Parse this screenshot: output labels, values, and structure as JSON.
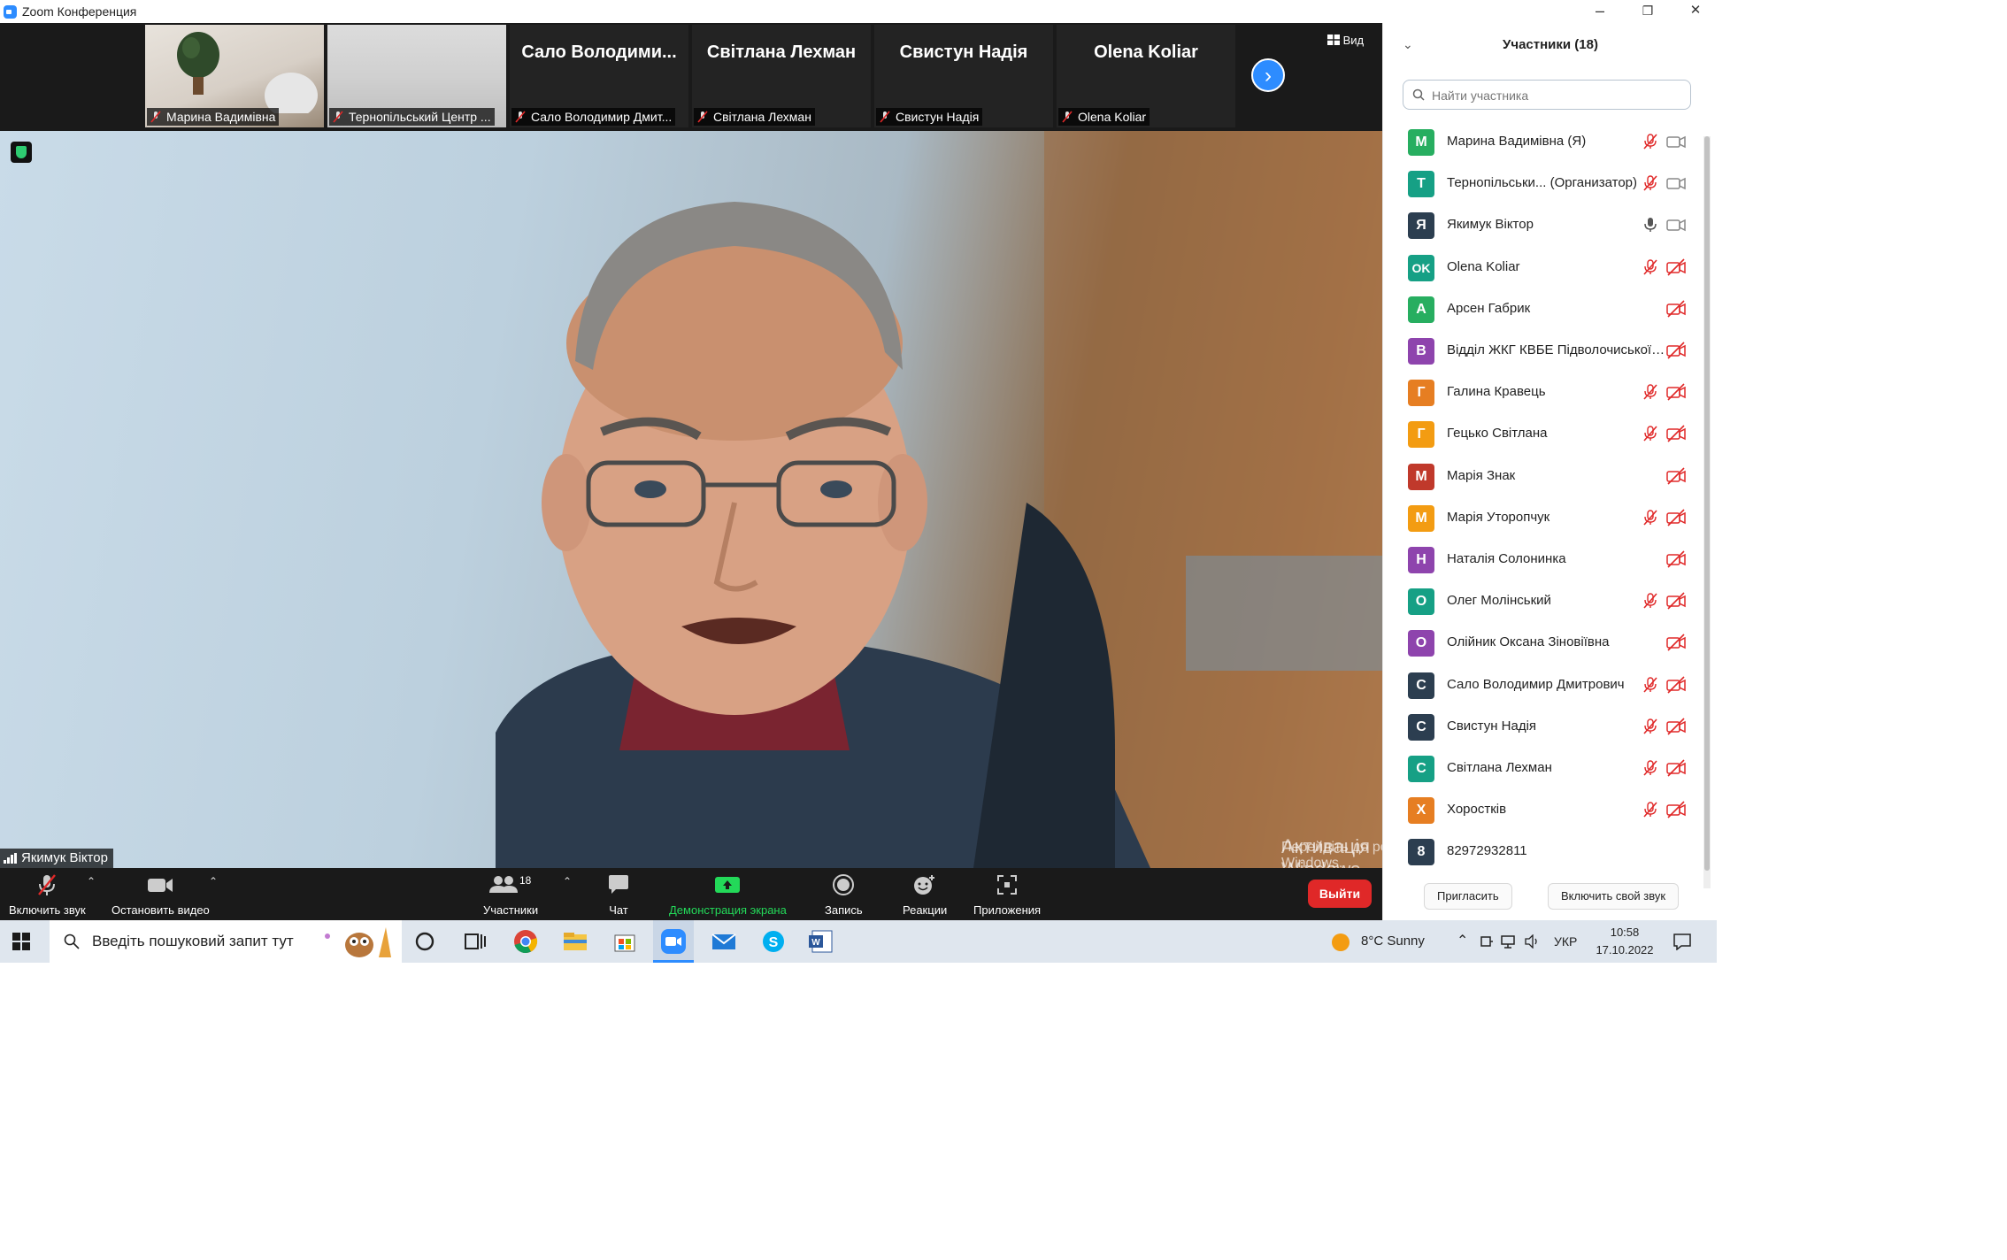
{
  "window": {
    "title": "Zoom Конференция",
    "minimize": "–",
    "maximize": "❐",
    "close": "✕"
  },
  "strip": {
    "view_label": "Вид",
    "tiles": [
      {
        "label": "Марина Вадимівна",
        "name": ""
      },
      {
        "label": "Тернопільський Центр ...",
        "name": ""
      },
      {
        "label": "Сало Володимир Дмит...",
        "name": "Сало  Володими..."
      },
      {
        "label": "Світлана Лехман",
        "name": "Світлана Лехман"
      },
      {
        "label": "Свистун Надія",
        "name": "Свистун Надія"
      },
      {
        "label": "Olena Koliar",
        "name": "Olena Koliar"
      }
    ]
  },
  "main": {
    "speaker": "Якимук Віктор"
  },
  "toolbar": {
    "mute": "Включить звук",
    "video": "Остановить видео",
    "participants": "Участники",
    "participants_count": "18",
    "chat": "Чат",
    "share": "Демонстрация экрана",
    "record": "Запись",
    "reactions": "Реакции",
    "apps": "Приложения",
    "leave": "Выйти"
  },
  "panel": {
    "title": "Участники (18)",
    "search_placeholder": "Найти участника",
    "invite": "Пригласить",
    "unmute_me": "Включить свой звук",
    "participants": [
      {
        "initial": "М",
        "name": "Марина Вадимівна  (Я)",
        "color": "#27ae60",
        "mic": "off",
        "cam": "on"
      },
      {
        "initial": "Т",
        "name": "Тернопільськи...  (Организатор)",
        "color": "#16a085",
        "mic": "off",
        "cam": "on"
      },
      {
        "initial": "Я",
        "name": "Якимук Віктор",
        "color": "#2c3e50",
        "mic": "on",
        "cam": "on"
      },
      {
        "initial": "OK",
        "name": "Olena Koliar",
        "color": "#16a085",
        "mic": "off",
        "cam": "off"
      },
      {
        "initial": "А",
        "name": "Арсен Габрик",
        "color": "#27ae60",
        "mic": "none",
        "cam": "off"
      },
      {
        "initial": "В",
        "name": "Відділ ЖКГ КВБЕ Підволочиської с...",
        "color": "#8e44ad",
        "mic": "none",
        "cam": "off"
      },
      {
        "initial": "Г",
        "name": "Галина Кравець",
        "color": "#e67e22",
        "mic": "off",
        "cam": "off"
      },
      {
        "initial": "Г",
        "name": "Гецько Світлана",
        "color": "#f39c12",
        "mic": "off",
        "cam": "off"
      },
      {
        "initial": "М",
        "name": "Марія Знак",
        "color": "#c0392b",
        "mic": "none",
        "cam": "off"
      },
      {
        "initial": "М",
        "name": "Марія Уторопчук",
        "color": "#f39c12",
        "mic": "off",
        "cam": "off"
      },
      {
        "initial": "Н",
        "name": "Наталія Солонинка",
        "color": "#8e44ad",
        "mic": "none",
        "cam": "off"
      },
      {
        "initial": "О",
        "name": "Олег Молінський",
        "color": "#16a085",
        "mic": "off",
        "cam": "off"
      },
      {
        "initial": "О",
        "name": "Олійник Оксана Зіновіївна",
        "color": "#8e44ad",
        "mic": "none",
        "cam": "off"
      },
      {
        "initial": "С",
        "name": "Сало Володимир Дмитрович",
        "color": "#2c3e50",
        "mic": "off",
        "cam": "off"
      },
      {
        "initial": "С",
        "name": "Свистун Надія",
        "color": "#2c3e50",
        "mic": "off",
        "cam": "off"
      },
      {
        "initial": "С",
        "name": "Світлана Лехман",
        "color": "#16a085",
        "mic": "off",
        "cam": "off"
      },
      {
        "initial": "Х",
        "name": "Хоростків",
        "color": "#e67e22",
        "mic": "off",
        "cam": "off"
      },
      {
        "initial": "8",
        "name": "82972932811",
        "color": "#2c3e50",
        "mic": "none",
        "cam": "none"
      }
    ]
  },
  "watermark": {
    "title": "Активація Windows",
    "subtitle": "Перейдіть до розділу \"Настройки\", щоб активувати Windows."
  },
  "taskbar": {
    "search_text": "Введіть пошуковий запит тут",
    "weather": "8°C  Sunny",
    "language": "УКР",
    "time": "10:58",
    "date": "17.10.2022"
  }
}
